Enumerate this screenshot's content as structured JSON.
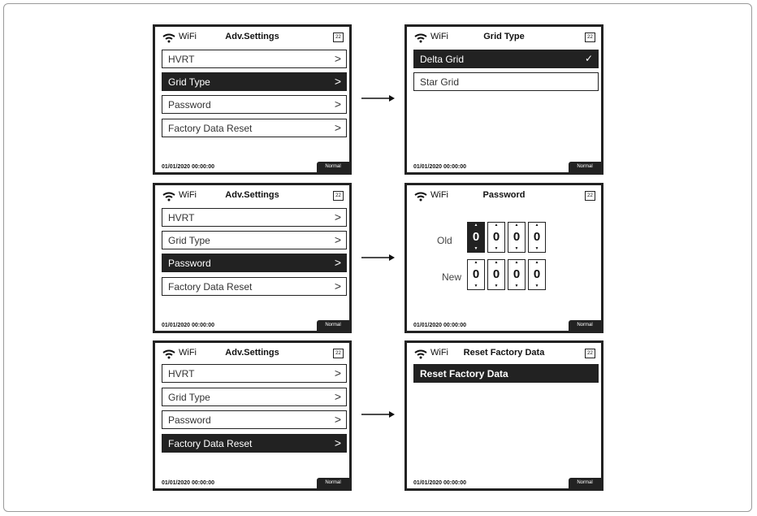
{
  "common": {
    "wifi_label": "WiFi",
    "date": "01/01/2020 00:00:00",
    "status": "Normal",
    "badge": "22",
    "chevron": ">",
    "check": "✓"
  },
  "row1": {
    "left": {
      "title": "Adv.Settings",
      "items": [
        "HVRT",
        "Grid Type",
        "Password",
        "Factory Data Reset"
      ],
      "selected": "Grid Type"
    },
    "right": {
      "title": "Grid Type",
      "items": [
        "Delta Grid",
        "Star Grid"
      ],
      "selected": "Delta Grid"
    }
  },
  "row2": {
    "left": {
      "title": "Adv.Settings",
      "items": [
        "HVRT",
        "Grid Type",
        "Password",
        "Factory Data Reset"
      ],
      "selected": "Password"
    },
    "right": {
      "title": "Password",
      "old_label": "Old",
      "new_label": "New",
      "old_digits": [
        "0",
        "0",
        "0",
        "0"
      ],
      "new_digits": [
        "0",
        "0",
        "0",
        "0"
      ],
      "up_glyph": "▲",
      "down_glyph": "▼"
    }
  },
  "row3": {
    "left": {
      "title": "Adv.Settings",
      "items": [
        "HVRT",
        "Grid Type",
        "Password",
        "Factory Data Reset"
      ],
      "selected": "Factory Data Reset"
    },
    "right": {
      "title": "Reset Factory Data",
      "banner": "Reset Factory Data"
    }
  },
  "colors": {
    "dark": "#222222",
    "border": "#9a9a9a"
  }
}
